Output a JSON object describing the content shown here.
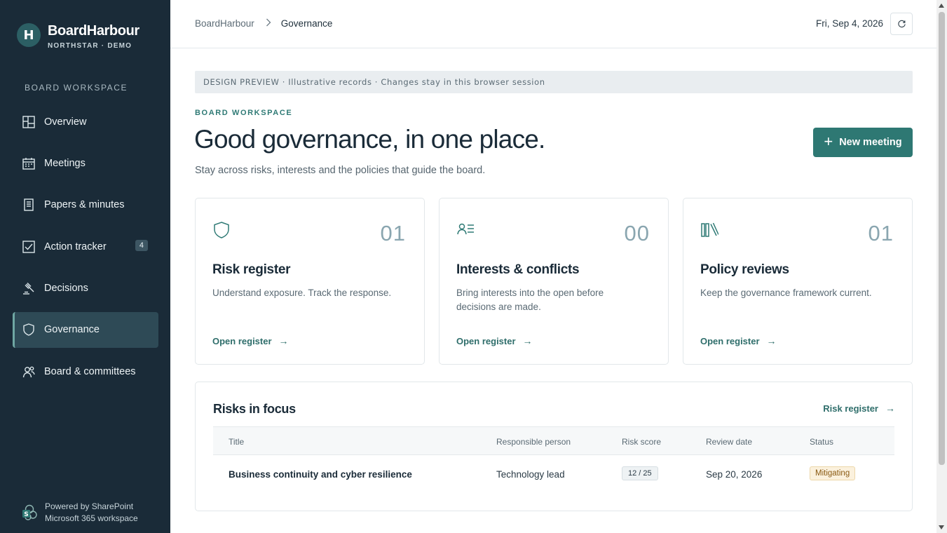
{
  "brand": {
    "name": "BoardHarbour",
    "subtitle": "NORTHSTAR · DEMO",
    "logo_letter": "H"
  },
  "sidebar": {
    "heading": "BOARD WORKSPACE",
    "items": [
      {
        "label": "Overview",
        "icon": "layout-icon"
      },
      {
        "label": "Meetings",
        "icon": "calendar-icon"
      },
      {
        "label": "Papers & minutes",
        "icon": "document-icon"
      },
      {
        "label": "Action tracker",
        "icon": "checkbox-icon",
        "badge": "4"
      },
      {
        "label": "Decisions",
        "icon": "gavel-icon"
      },
      {
        "label": "Governance",
        "icon": "shield-icon",
        "active": true
      },
      {
        "label": "Board & committees",
        "icon": "people-icon"
      }
    ],
    "footer": {
      "line1": "Powered by SharePoint",
      "line2": "Microsoft 365 workspace"
    }
  },
  "topbar": {
    "breadcrumb": {
      "root": "BoardHarbour",
      "current": "Governance"
    },
    "date": "Fri, Sep 4, 2026"
  },
  "main": {
    "preview_banner": "DESIGN PREVIEW · Illustrative records · Changes stay in this browser session",
    "eyebrow": "BOARD WORKSPACE",
    "title": "Good governance, in one place.",
    "subtitle": "Stay across risks, interests and the policies that guide the board.",
    "new_meeting_label": "New meeting",
    "cards": [
      {
        "count": "01",
        "title": "Risk register",
        "description": "Understand exposure. Track the response.",
        "link": "Open register",
        "icon": "shield-icon"
      },
      {
        "count": "00",
        "title": "Interests & conflicts",
        "description": "Bring interests into the open before decisions are made.",
        "link": "Open register",
        "icon": "person-list-icon"
      },
      {
        "count": "01",
        "title": "Policy reviews",
        "description": "Keep the governance framework current.",
        "link": "Open register",
        "icon": "books-icon"
      }
    ],
    "risks": {
      "title": "Risks in focus",
      "link": "Risk register",
      "columns": [
        "Title",
        "Responsible person",
        "Risk score",
        "Review date",
        "Status"
      ],
      "rows": [
        {
          "title": "Business continuity and cyber resilience",
          "person": "Technology lead",
          "score": "12 / 25",
          "review_date": "Sep 20, 2026",
          "status": "Mitigating"
        }
      ]
    }
  },
  "colors": {
    "sidebar_bg": "#1a2b38",
    "accent": "#2e7873",
    "status_mitigating": "#fbf1dd"
  }
}
